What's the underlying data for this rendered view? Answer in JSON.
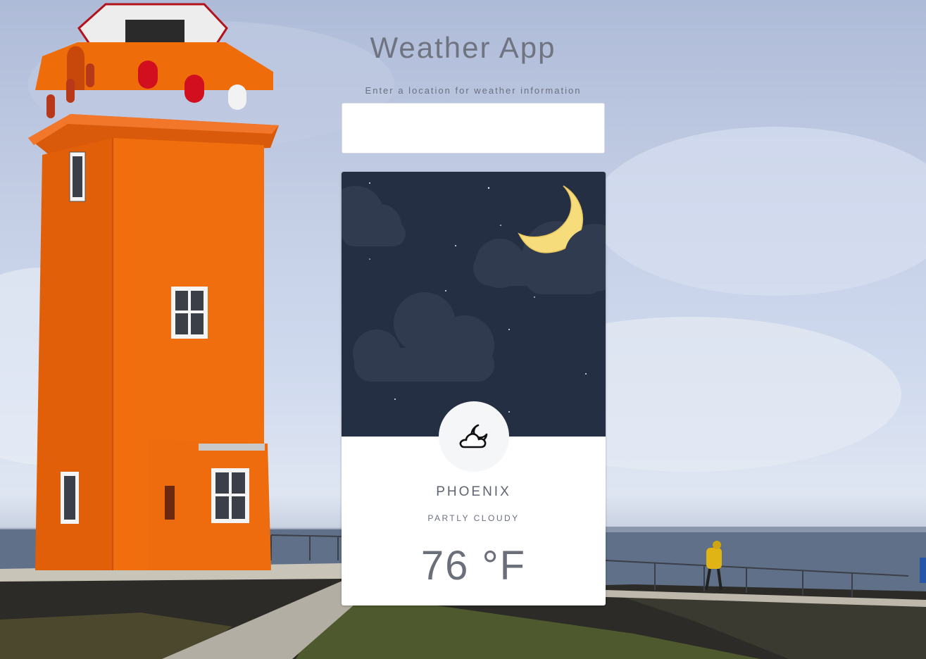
{
  "app": {
    "title": "Weather App",
    "subtitle": "Enter a location for weather information"
  },
  "search": {
    "value": "",
    "placeholder": ""
  },
  "weather": {
    "city": "PHOENIX",
    "condition": "PARTLY CLOUDY",
    "temperature": "76 °F",
    "icon": "partly-cloudy-night-icon",
    "scene_icon": "crescent-moon-icon"
  },
  "colors": {
    "sky": "#252f44",
    "cloud": "#313b4f",
    "moon": "#f7dc7c",
    "text_muted": "#6f7480",
    "lighthouse": "#ef6c0b"
  }
}
